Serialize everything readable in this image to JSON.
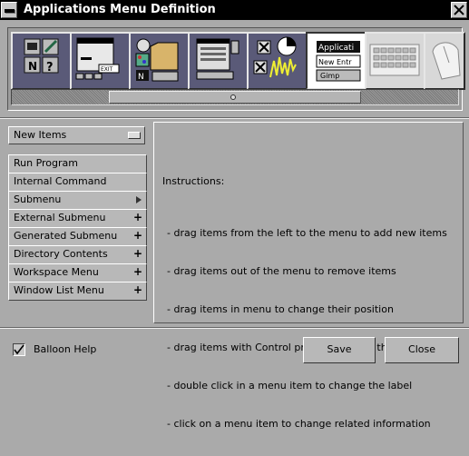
{
  "window": {
    "title": "Applications Menu Definition"
  },
  "icons": [
    {
      "name": "workspace-icons-tile",
      "icon": "grid-icons-icon"
    },
    {
      "name": "workspace-menu-tile",
      "icon": "menu-window-icon"
    },
    {
      "name": "folder-tools-tile",
      "icon": "folder-icon"
    },
    {
      "name": "windows-tile",
      "icon": "window-icon"
    },
    {
      "name": "misc-tile",
      "icon": "mixer-icon"
    },
    {
      "name": "menu-editor-tile",
      "icon": "menu-editor-icon",
      "labels": [
        "Applicati",
        "New Entr",
        "Gimp"
      ]
    },
    {
      "name": "keyboard-tile",
      "icon": "keyboard-icon"
    },
    {
      "name": "mouse-tile",
      "icon": "mouse-icon"
    }
  ],
  "popup": {
    "label": "New Items"
  },
  "items": [
    {
      "label": "Run Program",
      "suffix": ""
    },
    {
      "label": "Internal Command",
      "suffix": ""
    },
    {
      "label": "Submenu",
      "suffix": "arrow"
    },
    {
      "label": "External Submenu",
      "suffix": "+"
    },
    {
      "label": "Generated Submenu",
      "suffix": "+"
    },
    {
      "label": "Directory Contents",
      "suffix": "+"
    },
    {
      "label": "Workspace Menu",
      "suffix": "+"
    },
    {
      "label": "Window List Menu",
      "suffix": "+"
    }
  ],
  "instructions": {
    "heading": "Instructions:",
    "lines": [
      "- drag items from the left to the menu to add new items",
      "- drag items out of the menu to remove items",
      "- drag items in menu to change their position",
      "- drag items with Control pressed to copy them",
      "- double click in a menu item to change the label",
      "- click on a menu item to change related information"
    ]
  },
  "footer": {
    "balloon_help": "Balloon Help",
    "balloon_checked": true,
    "save": "Save",
    "close": "Close"
  },
  "colors": {
    "titlebar": "#000000",
    "background": "#aaaaaa",
    "tile": "#5a5a78"
  }
}
